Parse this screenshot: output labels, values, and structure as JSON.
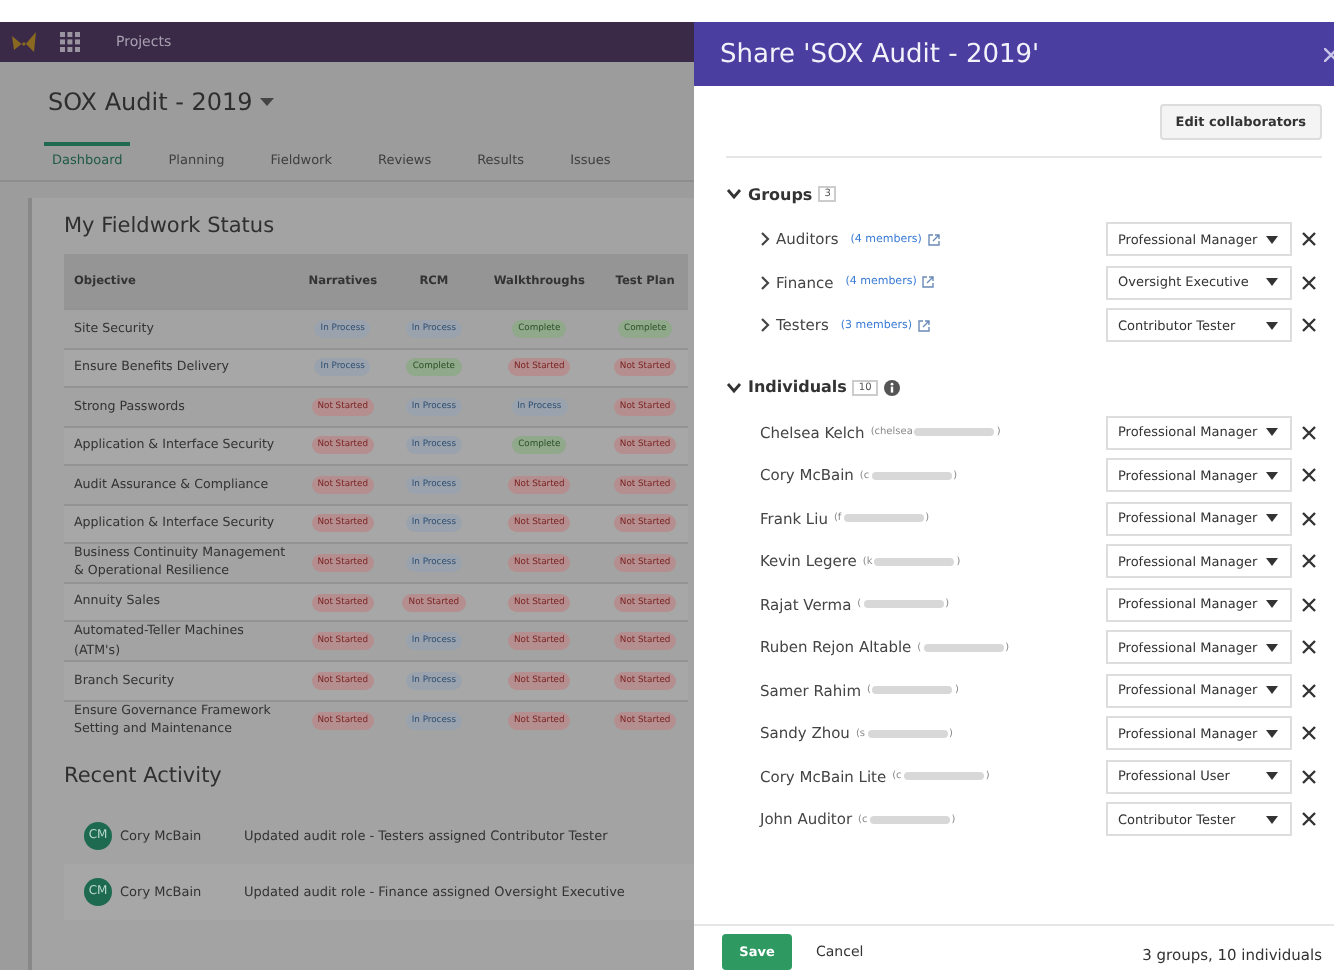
{
  "app": {
    "nav_label": "Projects",
    "project_title": "SOX Audit - 2019",
    "tabs": [
      {
        "label": "Dashboard",
        "selected": true
      },
      {
        "label": "Planning",
        "selected": false
      },
      {
        "label": "Fieldwork",
        "selected": false
      },
      {
        "label": "Reviews",
        "selected": false
      },
      {
        "label": "Results",
        "selected": false
      },
      {
        "label": "Issues",
        "selected": false
      }
    ],
    "fieldwork": {
      "title": "My Fieldwork Status",
      "columns": [
        "Objective",
        "Narratives",
        "RCM",
        "Walkthroughs",
        "Test Plan"
      ],
      "rows": [
        {
          "objective": "Site Security",
          "statuses": [
            {
              "label": "In Process",
              "kind": "in_process"
            },
            {
              "label": "In Process",
              "kind": "in_process"
            },
            {
              "label": "Complete",
              "kind": "complete"
            },
            {
              "label": "Complete",
              "kind": "complete"
            }
          ]
        },
        {
          "objective": "Ensure Benefits Delivery",
          "statuses": [
            {
              "label": "In Process",
              "kind": "in_process"
            },
            {
              "label": "Complete",
              "kind": "complete"
            },
            {
              "label": "Not Started",
              "kind": "not_started"
            },
            {
              "label": "Not Started",
              "kind": "not_started"
            }
          ]
        },
        {
          "objective": "Strong Passwords",
          "statuses": [
            {
              "label": "Not Started",
              "kind": "not_started"
            },
            {
              "label": "In Process",
              "kind": "in_process"
            },
            {
              "label": "In Process",
              "kind": "in_process"
            },
            {
              "label": "Not Started",
              "kind": "not_started"
            }
          ]
        },
        {
          "objective": "Application & Interface Security",
          "statuses": [
            {
              "label": "Not Started",
              "kind": "not_started"
            },
            {
              "label": "In Process",
              "kind": "in_process"
            },
            {
              "label": "Complete",
              "kind": "complete"
            },
            {
              "label": "Not Started",
              "kind": "not_started"
            }
          ]
        },
        {
          "objective": "Audit Assurance & Compliance",
          "statuses": [
            {
              "label": "Not Started",
              "kind": "not_started"
            },
            {
              "label": "In Process",
              "kind": "in_process"
            },
            {
              "label": "Not Started",
              "kind": "not_started"
            },
            {
              "label": "Not Started",
              "kind": "not_started"
            }
          ]
        },
        {
          "objective": "Application & Interface Security",
          "statuses": [
            {
              "label": "Not Started",
              "kind": "not_started"
            },
            {
              "label": "In Process",
              "kind": "in_process"
            },
            {
              "label": "Not Started",
              "kind": "not_started"
            },
            {
              "label": "Not Started",
              "kind": "not_started"
            }
          ]
        },
        {
          "objective": "Business Continuity Management & Operational Resilience",
          "statuses": [
            {
              "label": "Not Started",
              "kind": "not_started"
            },
            {
              "label": "In Process",
              "kind": "in_process"
            },
            {
              "label": "Not Started",
              "kind": "not_started"
            },
            {
              "label": "Not Started",
              "kind": "not_started"
            }
          ]
        },
        {
          "objective": "Annuity Sales",
          "statuses": [
            {
              "label": "Not Started",
              "kind": "not_started"
            },
            {
              "label": "Not Started",
              "kind": "not_started"
            },
            {
              "label": "Not Started",
              "kind": "not_started"
            },
            {
              "label": "Not Started",
              "kind": "not_started"
            }
          ]
        },
        {
          "objective": "Automated-Teller Machines (ATM's)",
          "statuses": [
            {
              "label": "Not Started",
              "kind": "not_started"
            },
            {
              "label": "In Process",
              "kind": "in_process"
            },
            {
              "label": "Not Started",
              "kind": "not_started"
            },
            {
              "label": "Not Started",
              "kind": "not_started"
            }
          ]
        },
        {
          "objective": "Branch Security",
          "statuses": [
            {
              "label": "Not Started",
              "kind": "not_started"
            },
            {
              "label": "In Process",
              "kind": "in_process"
            },
            {
              "label": "Not Started",
              "kind": "not_started"
            },
            {
              "label": "Not Started",
              "kind": "not_started"
            }
          ]
        },
        {
          "objective": "Ensure Governance Framework Setting and Maintenance",
          "statuses": [
            {
              "label": "Not Started",
              "kind": "not_started"
            },
            {
              "label": "In Process",
              "kind": "in_process"
            },
            {
              "label": "Not Started",
              "kind": "not_started"
            },
            {
              "label": "Not Started",
              "kind": "not_started"
            }
          ]
        }
      ]
    },
    "recent_activity": {
      "title": "Recent Activity",
      "items": [
        {
          "initials": "CM",
          "user": "Cory McBain",
          "action": "Updated audit role - Testers assigned Contributor Tester"
        },
        {
          "initials": "CM",
          "user": "Cory McBain",
          "action": "Updated audit role - Finance assigned Oversight Executive"
        }
      ]
    }
  },
  "share_dialog": {
    "title": "Share 'SOX Audit - 2019'",
    "edit_button": "Edit collaborators",
    "groups": {
      "label": "Groups",
      "count": "3",
      "expanded": true,
      "items": [
        {
          "name": "Auditors",
          "members": "(4 members)",
          "expanded": false,
          "role": "Professional Manager"
        },
        {
          "name": "Finance",
          "members": "(4 members)",
          "expanded": false,
          "role": "Oversight Executive"
        },
        {
          "name": "Testers",
          "members": "(3 members)",
          "expanded": false,
          "role": "Contributor Tester"
        }
      ]
    },
    "individuals": {
      "label": "Individuals",
      "count": "10",
      "expanded": true,
      "items": [
        {
          "name": "Chelsea Kelch",
          "email_start": "(chelsea",
          "email_end": ")",
          "role": "Professional Manager"
        },
        {
          "name": "Cory McBain",
          "email_start": "(c",
          "email_end": ")",
          "role": "Professional Manager"
        },
        {
          "name": "Frank Liu",
          "email_start": "(f",
          "email_end": ")",
          "role": "Professional Manager"
        },
        {
          "name": "Kevin Legere",
          "email_start": "(k",
          "email_end": ")",
          "role": "Professional Manager"
        },
        {
          "name": "Rajat Verma",
          "email_start": "(",
          "email_end": ")",
          "role": "Professional Manager"
        },
        {
          "name": "Ruben Rejon Altable",
          "email_start": "(",
          "email_end": ")",
          "role": "Professional Manager"
        },
        {
          "name": "Samer Rahim",
          "email_start": "(",
          "email_end": ")",
          "role": "Professional Manager"
        },
        {
          "name": "Sandy Zhou",
          "email_start": "(s",
          "email_end": ")",
          "role": "Professional Manager"
        },
        {
          "name": "Cory McBain Lite",
          "email_start": "(c",
          "email_end": ")",
          "role": "Professional User"
        },
        {
          "name": "John Auditor",
          "email_start": "(c",
          "email_end": ")",
          "role": "Contributor Tester"
        }
      ]
    },
    "footer": {
      "save": "Save",
      "cancel": "Cancel",
      "summary": "3 groups, 10 individuals"
    }
  }
}
